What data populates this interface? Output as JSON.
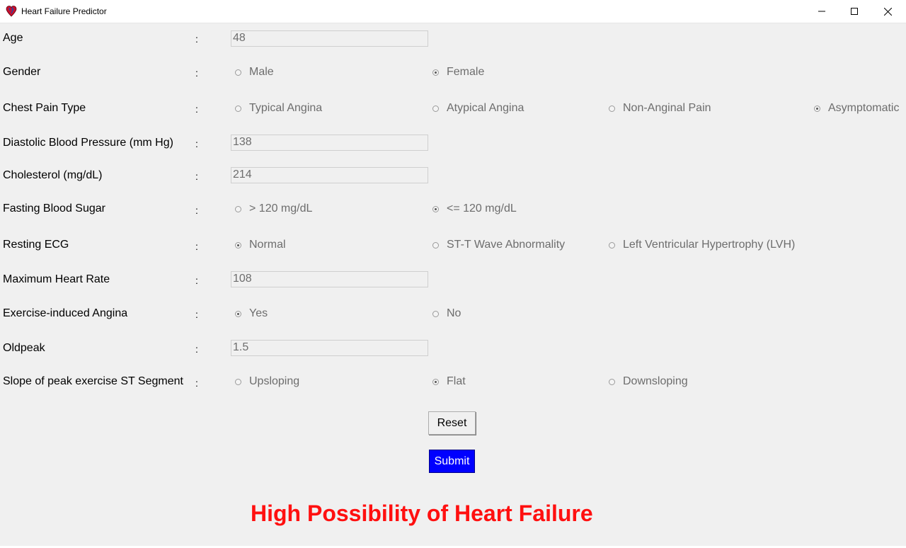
{
  "window": {
    "title": "Heart Failure Predictor",
    "controls": {
      "minimize": "minimize-icon",
      "maximize": "maximize-icon",
      "close": "close-icon"
    }
  },
  "form": {
    "colon": ":",
    "age": {
      "label": "Age",
      "value": "48"
    },
    "gender": {
      "label": "Gender",
      "options": [
        "Male",
        "Female"
      ],
      "selected": "Female"
    },
    "chest_pain": {
      "label": "Chest Pain Type",
      "options": [
        "Typical Angina",
        "Atypical Angina",
        "Non-Anginal Pain",
        "Asymptomatic"
      ],
      "selected": "Asymptomatic"
    },
    "bp": {
      "label": "Diastolic Blood Pressure (mm Hg)",
      "value": "138"
    },
    "cholesterol": {
      "label": "Cholesterol (mg/dL)",
      "value": "214"
    },
    "fbs": {
      "label": "Fasting Blood Sugar",
      "options": [
        "> 120 mg/dL",
        "<= 120 mg/dL"
      ],
      "selected": "<= 120 mg/dL"
    },
    "ecg": {
      "label": "Resting ECG",
      "options": [
        "Normal",
        "ST-T Wave Abnormality",
        "Left Ventricular Hypertrophy (LVH)"
      ],
      "selected": "Normal"
    },
    "max_hr": {
      "label": "Maximum Heart Rate",
      "value": "108"
    },
    "angina": {
      "label": "Exercise-induced Angina",
      "options": [
        "Yes",
        "No"
      ],
      "selected": "Yes"
    },
    "oldpeak": {
      "label": "Oldpeak",
      "value": "1.5"
    },
    "slope": {
      "label": "Slope of peak exercise ST Segment",
      "options": [
        "Upsloping",
        "Flat",
        "Downsloping"
      ],
      "selected": "Flat"
    }
  },
  "buttons": {
    "reset": "Reset",
    "submit": "Submit"
  },
  "result": {
    "text": "High Possibility of Heart Failure",
    "color": "#ff1010"
  },
  "colors": {
    "submit_bg": "#0000ff",
    "window_bg": "#f0f0f0"
  }
}
